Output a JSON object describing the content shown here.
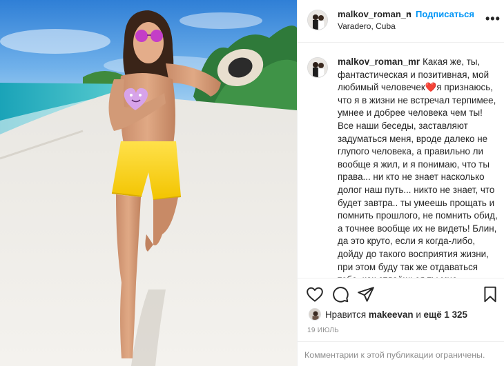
{
  "post": {
    "username": "malkov_roman_n",
    "separator": "•",
    "follow_label": "Подписаться",
    "location": "Varadero, Cuba",
    "more_icon": "more-icon",
    "more_label": "•••"
  },
  "caption": {
    "username": "malkov_roman_mr",
    "text": "Какая же, ты, фантастическая и позитивная, мой любимый человечек❤️я признаюсь, что я в жизни не встречал терпимее, умнее и добрее человека чем ты! Все наши беседы, заставляют задуматься меня, вроде далеко не глупого человека, а правильно ли вообще я жил, и я понимаю, что ты права... ни кто не знает насколько долог наш путь... никто не знает, что будет завтра.. ты умеешь прощать и помнить прошлого, не помнить обид, а точнее вообще их не видеть! Блин, да это круто, если я когда-либо, дойду до такого восприятия жизни, при этом буду так же отдаваться тебе, как отдаёшься ты мне, полностью и без остатка, я буду наверное, как и ты вечен) я"
  },
  "actions": {
    "like_icon": "heart-icon",
    "comment_icon": "comment-icon",
    "share_icon": "share-icon",
    "save_icon": "bookmark-icon"
  },
  "likes": {
    "prefix": "Нравится ",
    "user": "makeevan",
    "middle": " и ",
    "count": "ещё 1 325"
  },
  "date": "19 июль",
  "comments_notice": "Комментарии к этой публикации ограничены.",
  "colors": {
    "link_blue": "#0095f6",
    "text": "#262626",
    "muted": "#8e8e8e",
    "border": "#efefef"
  }
}
